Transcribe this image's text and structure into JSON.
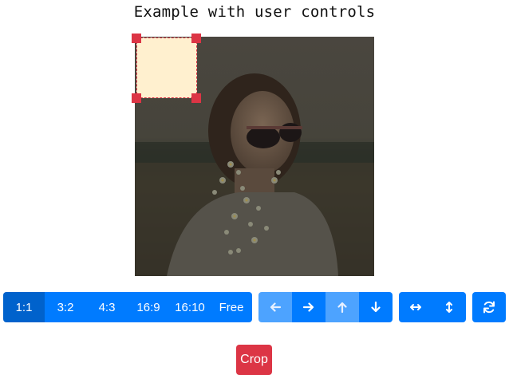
{
  "page": {
    "title": "Example with user controls"
  },
  "ratio_buttons": [
    "1:1",
    "3:2",
    "4:3",
    "16:9",
    "16:10",
    "Free"
  ],
  "ratio_active": "1:1",
  "move_controls": {
    "icons": [
      "arrow-left-icon",
      "arrow-right-icon",
      "arrow-up-icon",
      "arrow-down-icon"
    ],
    "disabled": [
      "arrow-left-icon",
      "arrow-up-icon"
    ]
  },
  "flip_controls": {
    "icons": [
      "flip-horizontal-icon",
      "flip-vertical-icon"
    ]
  },
  "reset_control": {
    "icon": "refresh-icon"
  },
  "crop_button": {
    "label": "Crop"
  },
  "colors": {
    "primary": "#007bff",
    "primary_active": "#0062cc",
    "primary_disabled": "#4da3ff",
    "danger": "#dc3545",
    "crop_fill": "#fff0cf"
  }
}
